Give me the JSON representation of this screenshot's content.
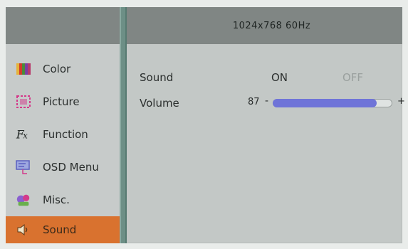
{
  "header": {
    "resolution": "1024x768  60Hz"
  },
  "sidebar": {
    "items": [
      {
        "label": "Color",
        "icon": "color-icon"
      },
      {
        "label": "Picture",
        "icon": "picture-icon"
      },
      {
        "label": "Function",
        "icon": "function-icon"
      },
      {
        "label": "OSD  Menu",
        "icon": "osd-menu-icon"
      },
      {
        "label": "Misc.",
        "icon": "misc-icon"
      },
      {
        "label": "Sound",
        "icon": "sound-icon",
        "active": true
      }
    ]
  },
  "sound": {
    "label": "Sound",
    "on_label": "ON",
    "off_label": "OFF",
    "selected": "ON"
  },
  "volume": {
    "label": "Volume",
    "value": "87",
    "minus": "-",
    "plus": "+",
    "level": 0.87
  },
  "colors": {
    "active_bg": "#d9722f",
    "slider_fill": "#6f74d8",
    "header_bg": "#808684",
    "divider": "#6d8f86"
  }
}
